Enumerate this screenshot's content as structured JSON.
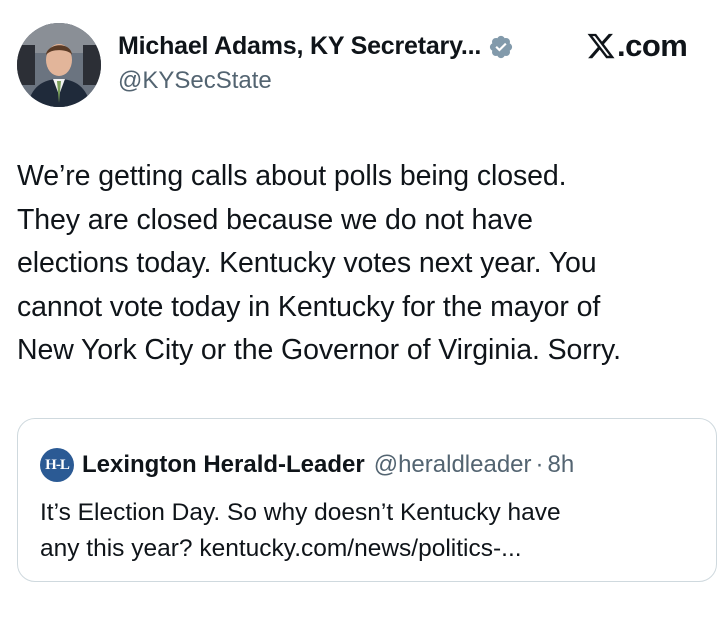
{
  "author": {
    "display_name": "Michael Adams, KY Secretary...",
    "handle": "@KYSecState",
    "verified": true
  },
  "brand": {
    "icon": "x-logo-icon",
    "text": ".com"
  },
  "tweet": {
    "lines": [
      "We’re getting calls about polls being closed.",
      "They are closed because we do not have",
      "elections today. Kentucky votes next year. You",
      "cannot vote today in Kentucky for the mayor of",
      "New York City or the Governor of Virginia. Sorry."
    ]
  },
  "quote": {
    "logo_text": "H-L",
    "name": "Lexington Herald-Leader",
    "handle": "@heraldleader",
    "separator": "·",
    "time": "8h",
    "lines": [
      "It’s Election Day. So why doesn’t Kentucky have",
      "any this year? kentucky.com/news/politics-..."
    ]
  },
  "colors": {
    "text": "#0f1419",
    "secondary": "#536471",
    "border": "#cfd9de",
    "verified_badge": "#829aab",
    "herald_leader_logo": "#2b5a94"
  }
}
